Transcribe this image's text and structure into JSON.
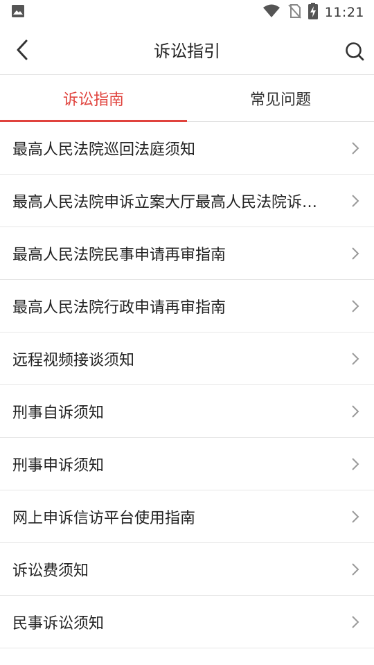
{
  "status_bar": {
    "time": "11:21",
    "icons": [
      "image-icon",
      "wifi-icon",
      "no-sim-icon",
      "battery-charging-icon"
    ]
  },
  "header": {
    "title": "诉讼指引",
    "back_icon": "back-arrow-icon",
    "search_icon": "search-icon"
  },
  "tabs": [
    {
      "label": "诉讼指南",
      "active": true
    },
    {
      "label": "常见问题",
      "active": false
    }
  ],
  "items": [
    {
      "label": "最高人民法院巡回法庭须知"
    },
    {
      "label": "最高人民法院申诉立案大厅最高人民法院诉…"
    },
    {
      "label": "最高人民法院民事申请再审指南"
    },
    {
      "label": "最高人民法院行政申请再审指南"
    },
    {
      "label": "远程视频接谈须知"
    },
    {
      "label": "刑事自诉须知"
    },
    {
      "label": "刑事申诉须知"
    },
    {
      "label": "网上申诉信访平台使用指南"
    },
    {
      "label": "诉讼费须知"
    },
    {
      "label": "民事诉讼须知"
    }
  ],
  "colors": {
    "accent": "#e0433d",
    "divider": "#e6e6e6",
    "text": "#222222"
  }
}
